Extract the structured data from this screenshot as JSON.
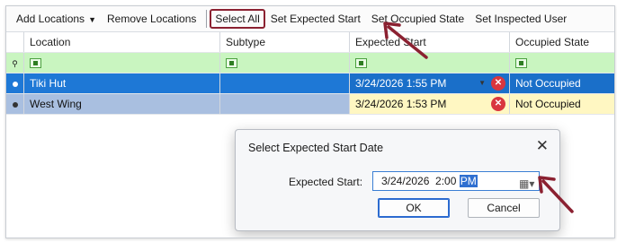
{
  "toolbar": {
    "add_locations": "Add Locations",
    "remove_locations": "Remove Locations",
    "select_all": "Select All",
    "set_expected_start": "Set Expected Start",
    "set_occupied_state": "Set Occupied State",
    "set_inspected_user": "Set Inspected User"
  },
  "grid": {
    "columns": [
      "Location",
      "Subtype",
      "Expected Start",
      "Occupied State"
    ],
    "rows": [
      {
        "location": "Tiki Hut",
        "subtype": "",
        "expected_start": "3/24/2026 1:55 PM",
        "occupied_state": "Not Occupied"
      },
      {
        "location": "West Wing",
        "subtype": "",
        "expected_start": "3/24/2026 1:53 PM",
        "occupied_state": "Not Occupied"
      }
    ]
  },
  "dialog": {
    "title": "Select Expected Start Date",
    "label": "Expected Start:",
    "value_date_time": "3/24/2026  2:00 ",
    "value_ampm": "PM",
    "ok_label": "OK",
    "cancel_label": "Cancel",
    "close_glyph": "✕"
  },
  "colors": {
    "highlight_box": "#8b2131",
    "selected_row": "#1e78d6",
    "secondary_row": "#a9bfe0",
    "filter_row": "#c9f5c0",
    "edited_cell": "#fff7c2"
  }
}
